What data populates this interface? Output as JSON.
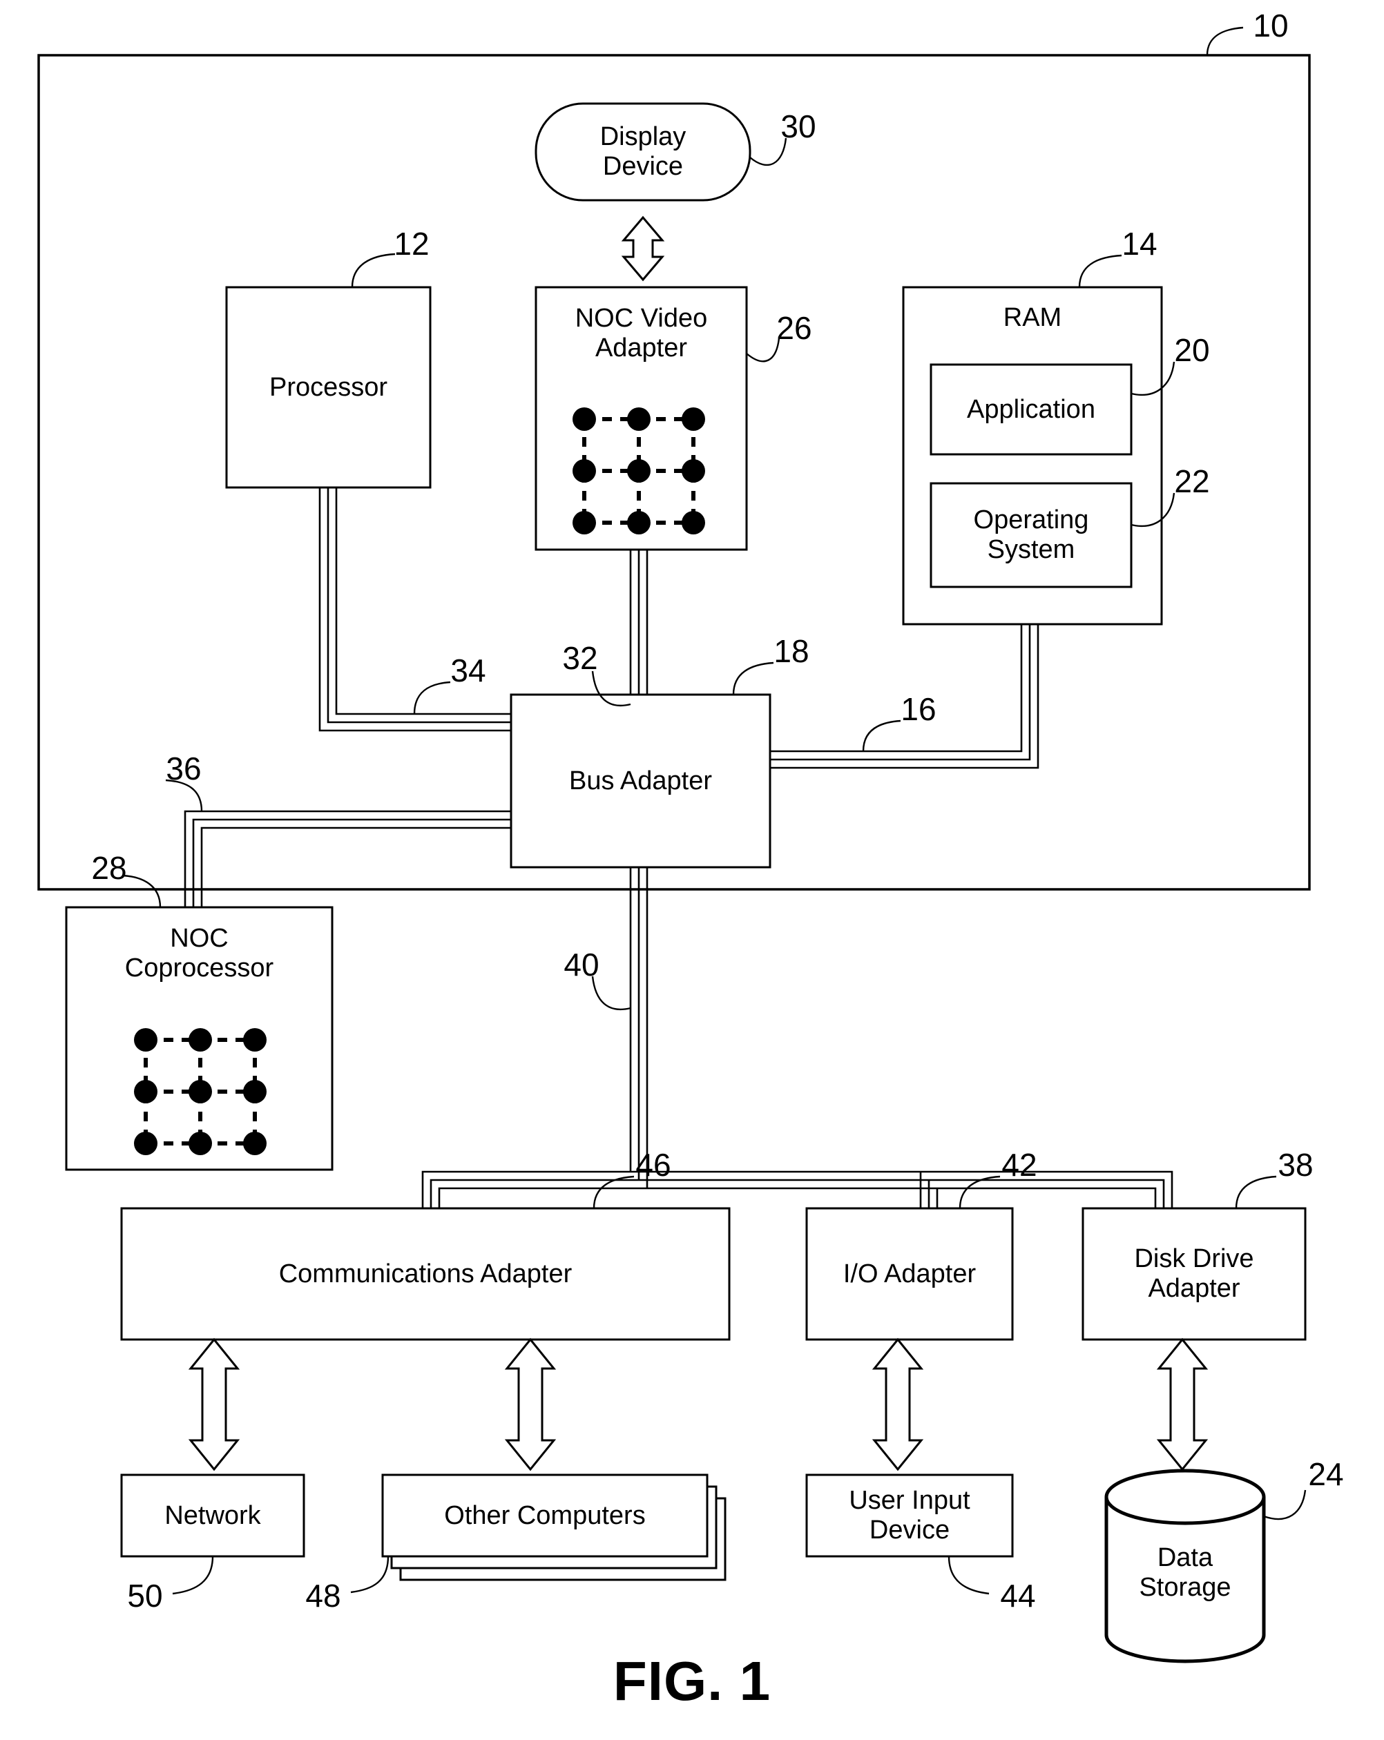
{
  "figure": {
    "caption": "FIG. 1",
    "enclosure_ref": "10"
  },
  "blocks": {
    "display_device": {
      "label": "Display\nDevice",
      "ref": "30"
    },
    "processor": {
      "label": "Processor",
      "ref": "12"
    },
    "noc_video": {
      "label": "NOC Video\nAdapter",
      "ref": "26"
    },
    "ram": {
      "label": "RAM",
      "ref": "14"
    },
    "application": {
      "label": "Application",
      "ref": "20"
    },
    "operating_system": {
      "label": "Operating\nSystem",
      "ref": "22"
    },
    "bus_adapter": {
      "label": "Bus Adapter",
      "ref": "18"
    },
    "noc_coprocessor": {
      "label": "NOC\nCoprocessor",
      "ref": "28"
    },
    "comm_adapter": {
      "label": "Communications Adapter",
      "ref": "46"
    },
    "io_adapter": {
      "label": "I/O Adapter",
      "ref": "42"
    },
    "disk_drive_adapter": {
      "label": "Disk Drive\nAdapter",
      "ref": "38"
    },
    "network": {
      "label": "Network",
      "ref": "50"
    },
    "other_computers": {
      "label": "Other Computers",
      "ref": "48"
    },
    "user_input": {
      "label": "User Input\nDevice",
      "ref": "44"
    },
    "data_storage": {
      "label": "Data\nStorage",
      "ref": "24"
    }
  },
  "buses": {
    "front_side_bus_ram": {
      "ref": "16"
    },
    "front_side_bus_video": {
      "ref": "32"
    },
    "front_side_bus_processor": {
      "ref": "34"
    },
    "front_side_bus_coproc": {
      "ref": "36"
    },
    "expansion_bus": {
      "ref": "40"
    }
  },
  "colors": {
    "line": "#000000",
    "background": "#ffffff"
  }
}
